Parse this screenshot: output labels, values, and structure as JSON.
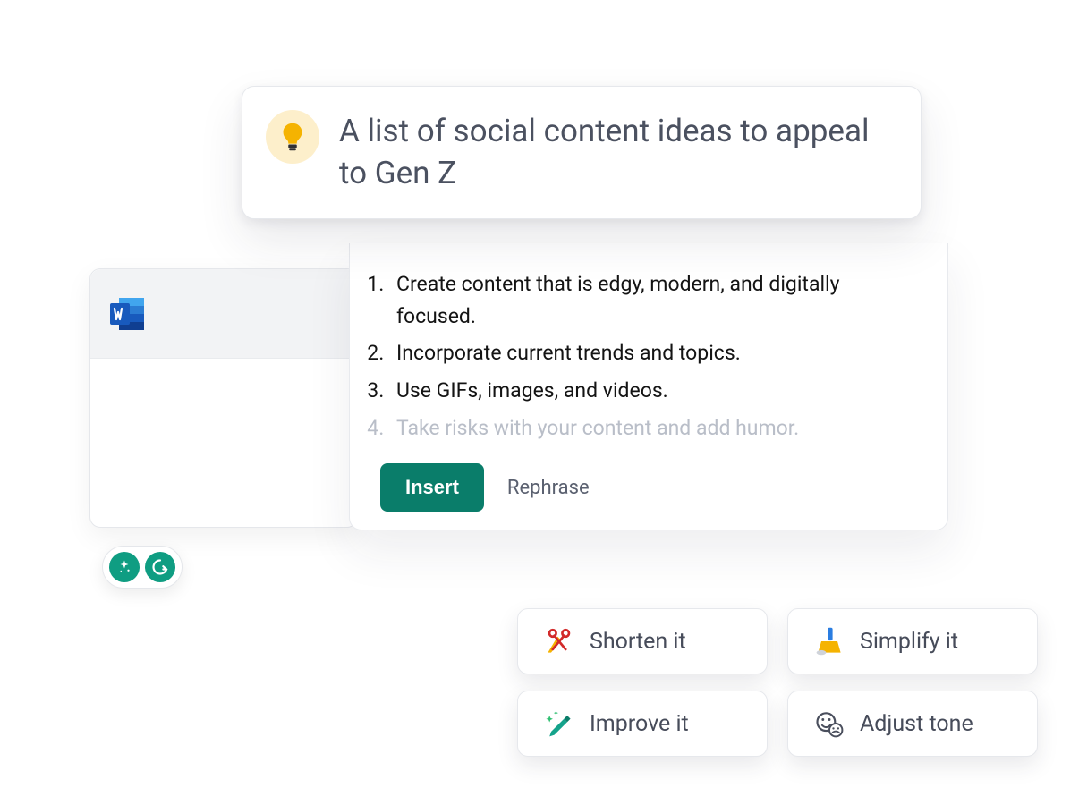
{
  "prompt": {
    "text": "A list of social content ideas to appeal to Gen Z"
  },
  "results": {
    "items": [
      "Create content that is edgy, modern, and digitally focused.",
      "Incorporate current trends and topics.",
      "Use GIFs, images, and videos.",
      "Take risks with your content and add humor."
    ],
    "faded_index": 3,
    "insert_label": "Insert",
    "rephrase_label": "Rephrase"
  },
  "chips": {
    "shorten": "Shorten it",
    "simplify": "Simplify it",
    "improve": "Improve it",
    "adjust_tone": "Adjust tone"
  },
  "icons": {
    "word": "word-icon",
    "bulb": "lightbulb-icon",
    "sparkle": "sparkle-icon",
    "grammarly": "grammarly-icon",
    "scissors": "scissors-icon",
    "broom": "broom-icon",
    "pencil": "pencil-sparkle-icon",
    "face": "face-adjust-icon"
  }
}
